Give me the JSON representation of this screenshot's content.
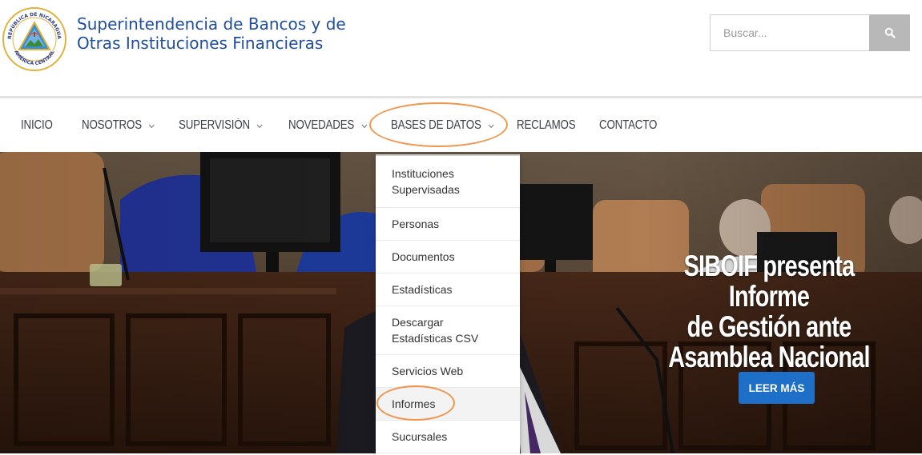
{
  "brand": {
    "line1": "Superintendencia de Bancos y de",
    "line2": "Otras Instituciones Financieras",
    "seal_text_top": "REPÚBLICA DE NICARAGUA",
    "seal_text_bottom": "AMÉRICA CENTRAL"
  },
  "search": {
    "placeholder": "Buscar...",
    "icon": "search-icon"
  },
  "nav": [
    {
      "label": "INICIO",
      "has_submenu": false
    },
    {
      "label": "NOSOTROS",
      "has_submenu": true
    },
    {
      "label": "SUPERVISIÓN",
      "has_submenu": true
    },
    {
      "label": "NOVEDADES",
      "has_submenu": true
    },
    {
      "label": "BASES DE DATOS",
      "has_submenu": true,
      "active": true
    },
    {
      "label": "RECLAMOS",
      "has_submenu": false
    },
    {
      "label": "CONTACTO",
      "has_submenu": false
    }
  ],
  "dropdown": {
    "items": [
      {
        "label": "Instituciones\nSupervisadas"
      },
      {
        "label": "Personas"
      },
      {
        "label": "Documentos"
      },
      {
        "label": "Estadísticas"
      },
      {
        "label": "Descargar\nEstadísticas CSV"
      },
      {
        "label": "Servicios Web"
      },
      {
        "label": "Informes",
        "highlighted": true
      },
      {
        "label": "Sucursales"
      }
    ]
  },
  "hero": {
    "headline_line1": "SIBOIF presenta Informe",
    "headline_line2": "de Gestión ante",
    "headline_line3": "Asamblea Nacional",
    "button_label": "LEER MÁS"
  },
  "colors": {
    "brand_blue": "#1f4e9a",
    "button_blue": "#1e6fc7",
    "annotation_orange": "#f0954a",
    "search_button_gray": "#b8b8b8"
  }
}
